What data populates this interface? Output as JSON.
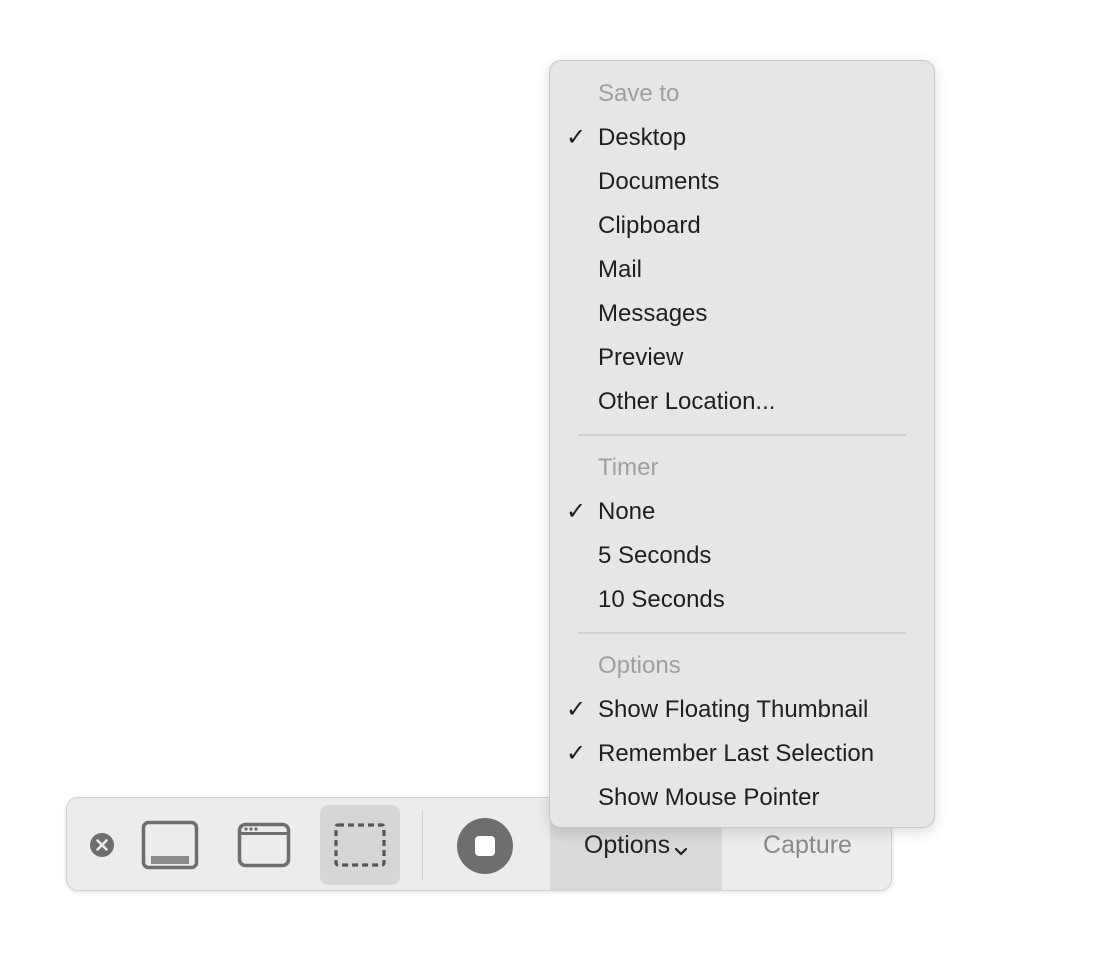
{
  "menu": {
    "sections": [
      {
        "header": "Save to",
        "items": [
          {
            "label": "Desktop",
            "checked": true
          },
          {
            "label": "Documents",
            "checked": false
          },
          {
            "label": "Clipboard",
            "checked": false
          },
          {
            "label": "Mail",
            "checked": false
          },
          {
            "label": "Messages",
            "checked": false
          },
          {
            "label": "Preview",
            "checked": false
          },
          {
            "label": "Other Location...",
            "checked": false
          }
        ]
      },
      {
        "header": "Timer",
        "items": [
          {
            "label": "None",
            "checked": true
          },
          {
            "label": "5 Seconds",
            "checked": false
          },
          {
            "label": "10 Seconds",
            "checked": false
          }
        ]
      },
      {
        "header": "Options",
        "items": [
          {
            "label": "Show Floating Thumbnail",
            "checked": true
          },
          {
            "label": "Remember Last Selection",
            "checked": true
          },
          {
            "label": "Show Mouse Pointer",
            "checked": false
          }
        ]
      }
    ],
    "check_glyph": "✓"
  },
  "toolbar": {
    "options_label": "Options",
    "options_chevron": "⌄",
    "capture_label": "Capture",
    "active_mode": "capture-selection"
  },
  "colors": {
    "menu_bg": "#e7e6e5",
    "toolbar_bg": "#ececec",
    "icon": "#6e6e6e",
    "header_text": "#9f9f9f"
  }
}
